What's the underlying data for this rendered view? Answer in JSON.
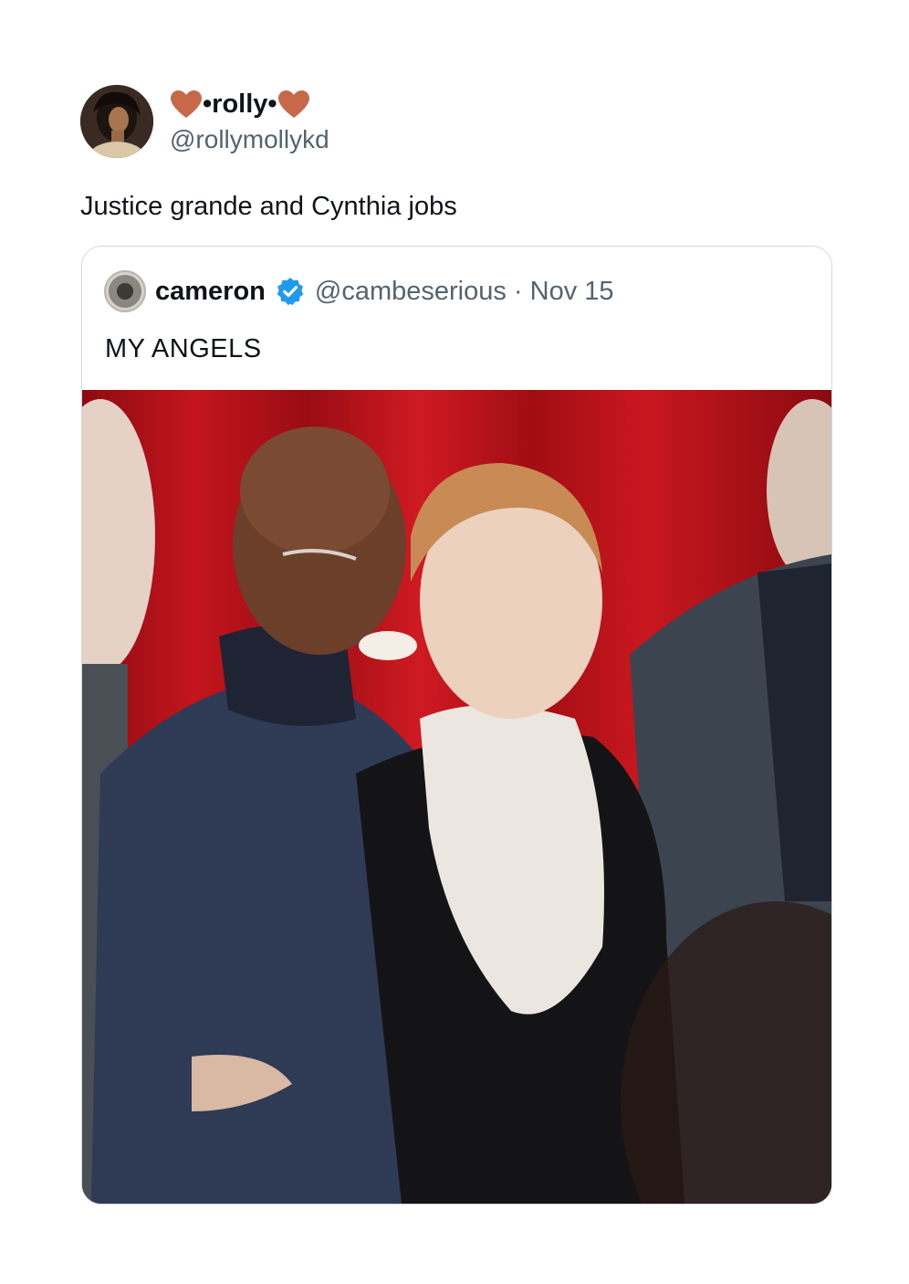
{
  "author": {
    "display_name": "•rolly•",
    "handle": "@rollymollykd",
    "avatar": "profile-photo",
    "heart_color": "#c8684a"
  },
  "tweet": {
    "text": "Justice grande and Cynthia jobs"
  },
  "quoted": {
    "name": "cameron",
    "verified": true,
    "verified_color": "#1d9bf0",
    "meta": "@cambeserious · Nov 15",
    "text": "MY ANGELS",
    "media": "photo of two women smiling in front of a red curtain"
  }
}
